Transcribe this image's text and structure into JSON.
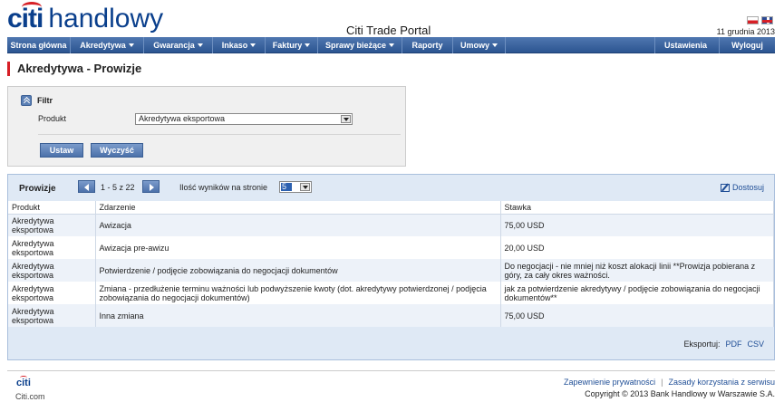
{
  "brand": {
    "logo_citi": "citi",
    "logo_name": "handlowy"
  },
  "header": {
    "portal_title": "Citi Trade Portal",
    "date": "11 grudnia 2013"
  },
  "nav": {
    "items": [
      {
        "label": "Strona główna",
        "dropdown": false
      },
      {
        "label": "Akredytywa",
        "dropdown": true
      },
      {
        "label": "Gwarancja",
        "dropdown": true
      },
      {
        "label": "Inkaso",
        "dropdown": true
      },
      {
        "label": "Faktury",
        "dropdown": true
      },
      {
        "label": "Sprawy bieżące",
        "dropdown": true
      },
      {
        "label": "Raporty",
        "dropdown": false
      },
      {
        "label": "Umowy",
        "dropdown": true
      }
    ],
    "right_items": [
      {
        "label": "Ustawienia",
        "dropdown": true
      },
      {
        "label": "Wyloguj",
        "dropdown": false
      }
    ]
  },
  "page": {
    "title": "Akredytywa - Prowizje"
  },
  "filter": {
    "title": "Filtr",
    "produkt_label": "Produkt",
    "produkt_value": "Akredytywa eksportowa",
    "apply_label": "Ustaw",
    "clear_label": "Wyczyść"
  },
  "results": {
    "title": "Prowizje",
    "range": "1 - 5 z 22",
    "per_page_label": "Ilość wyników na stronie",
    "per_page_value": "5",
    "customize_label": "Dostosuj",
    "columns": [
      "Produkt",
      "Zdarzenie",
      "Stawka"
    ],
    "rows": [
      {
        "produkt": "Akredytywa eksportowa",
        "zdarzenie": "Awizacja",
        "stawka": "75,00 USD"
      },
      {
        "produkt": "Akredytywa eksportowa",
        "zdarzenie": "Awizacja pre-awizu",
        "stawka": "20,00 USD"
      },
      {
        "produkt": "Akredytywa eksportowa",
        "zdarzenie": "Potwierdzenie / podjęcie zobowiązania do negocjacji dokumentów",
        "stawka": "Do negocjacji - nie mniej niż koszt alokacji linii **Prowizja pobierana z góry, za cały okres ważności."
      },
      {
        "produkt": "Akredytywa eksportowa",
        "zdarzenie": "Zmiana - przedłużenie terminu ważności lub podwyższenie kwoty (dot. akredytywy potwierdzonej / podjęcia zobowiązania do negocjacji dokumentów)",
        "stawka": "jak za potwierdzenie akredytywy / podjęcie zobowiązania do negocjacji dokumentów**"
      },
      {
        "produkt": "Akredytywa eksportowa",
        "zdarzenie": "Inna zmiana",
        "stawka": "75,00 USD"
      }
    ],
    "export_label": "Eksportuj:",
    "export_pdf": "PDF",
    "export_csv": "CSV"
  },
  "footer": {
    "logo": "citi",
    "site": "Citi.com",
    "privacy_link": "Zapewnienie prywatności",
    "separator": "|",
    "terms_link": "Zasady korzystania z serwisu",
    "copyright": "Copyright © 2013 Bank Handlowy w Warszawie S.A."
  }
}
